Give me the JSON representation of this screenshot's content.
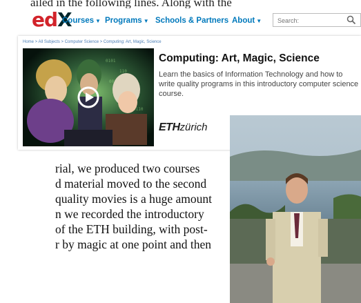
{
  "top_text": "ailed  in  the  following  lines.  Along  with  the",
  "nav": {
    "logo_ed": "ed",
    "logo_x": "X",
    "items": [
      "Courses",
      "Programs",
      "Schools & Partners",
      "About"
    ],
    "search_placeholder": "Search:",
    "search_icon": "magnifier-icon",
    "caret_icon": "caret-down-icon"
  },
  "course": {
    "breadcrumb": "Home > All Subjects > Computer Science > Computing: Art, Magic, Science",
    "title": "Computing: Art, Magic, Science",
    "description": "Learn the basics of Information Technology and how to write quality programs in this introductory computer science course.",
    "org_logo_bold": "ETH",
    "org_logo_rest": "zürich",
    "play_icon": "play-icon"
  },
  "paragraph": {
    "lines": [
      "rial,  we  produced  two  courses",
      "d material moved to the second",
      "quality movies is a huge amount",
      "n  we  recorded  the  introductory",
      "of  the  ETH  building,  with  post-",
      "r by magic at one point and then"
    ]
  },
  "colors": {
    "brand_red": "#d2232a",
    "brand_dark": "#02262b",
    "link_blue": "#0079bc"
  }
}
